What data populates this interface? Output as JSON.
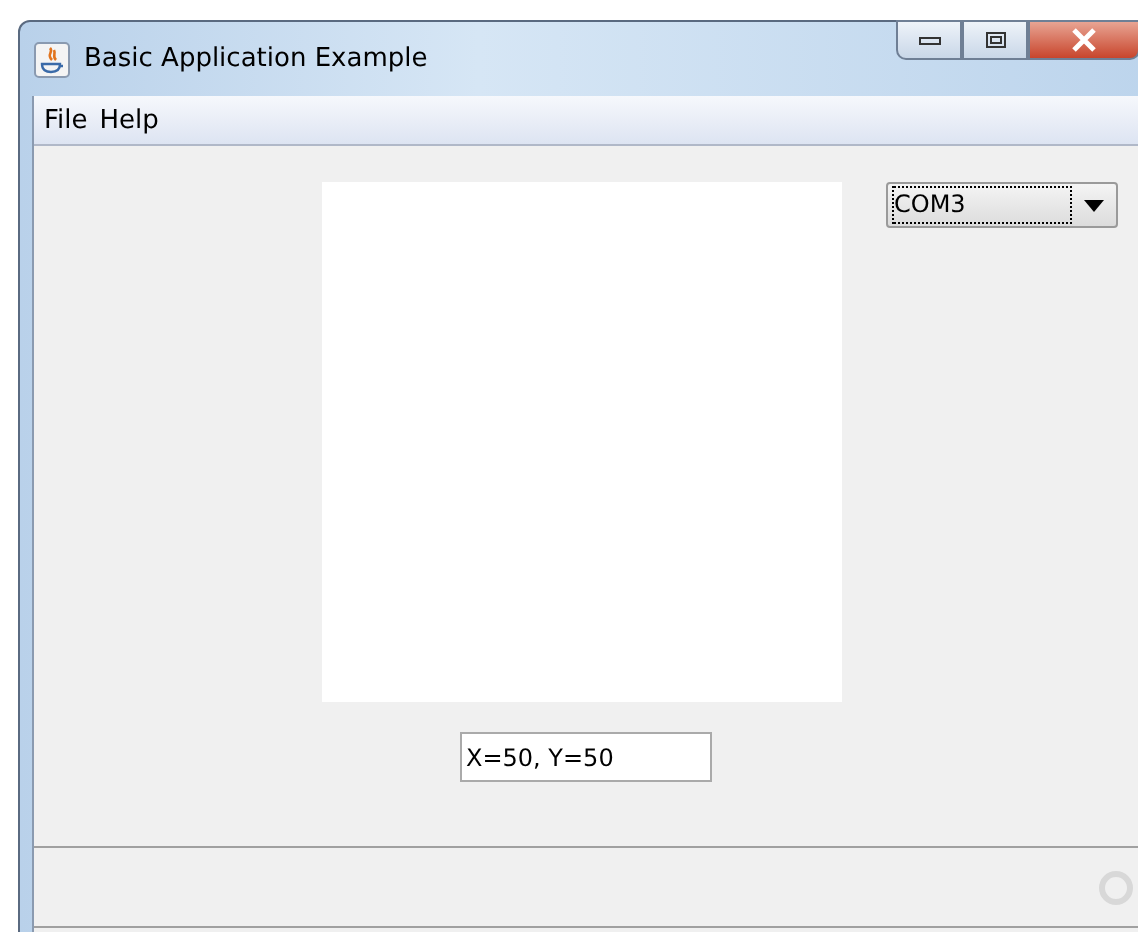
{
  "window": {
    "title": "Basic Application Example"
  },
  "menu": [
    {
      "label": "File"
    },
    {
      "label": "Help"
    }
  ],
  "port_select": {
    "value": "COM3"
  },
  "coordinates_field": {
    "value": "X=50, Y=50"
  }
}
